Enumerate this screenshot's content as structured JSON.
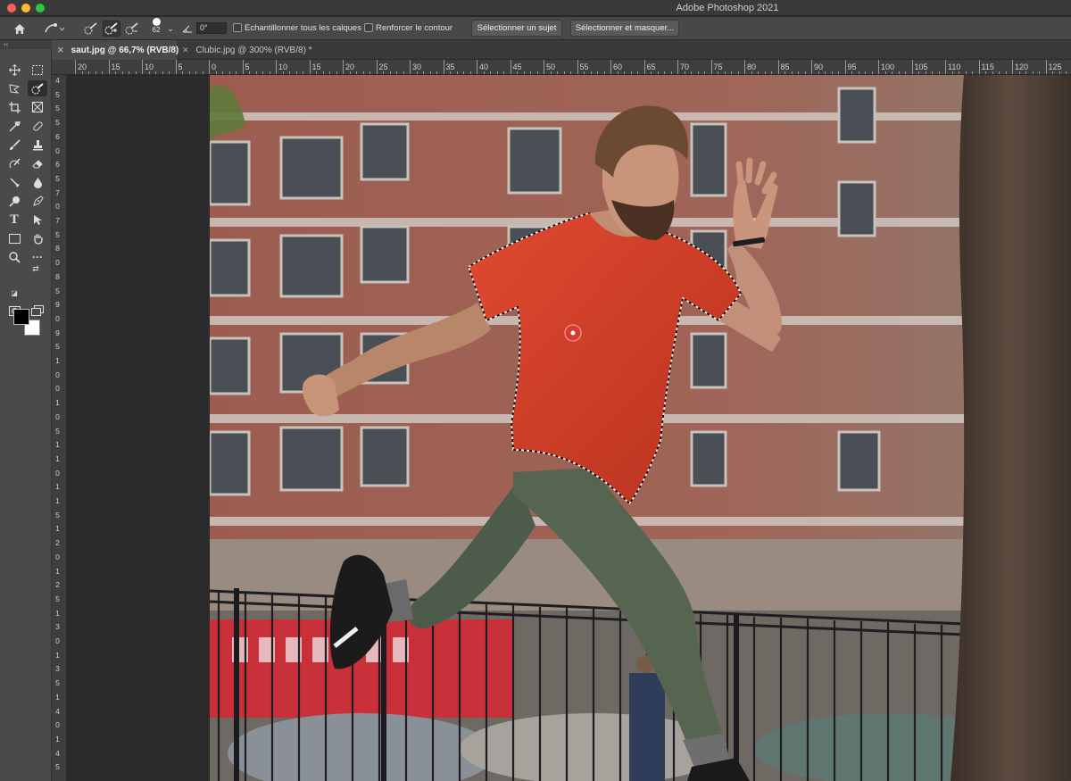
{
  "titlebar": {
    "app_title": "Adobe Photoshop 2021"
  },
  "options": {
    "brush_size": "62",
    "angle": "0°",
    "sample_all_layers": "Echantillonner tous les calques",
    "enhance_edge": "Renforcer le contour",
    "select_subject": "Sélectionner un sujet",
    "select_and_mask": "Sélectionner et masquer..."
  },
  "tabs": [
    {
      "label": "saut.jpg @ 66,7% (RVB/8)",
      "active": true
    },
    {
      "label": "Clubic.jpg @ 300% (RVB/8) *",
      "active": false
    }
  ],
  "ruler": {
    "top": [
      "20",
      "15",
      "10",
      "5",
      "0",
      "5",
      "10",
      "15",
      "20",
      "25",
      "30",
      "35",
      "40",
      "45",
      "50",
      "55",
      "60",
      "65",
      "70",
      "75",
      "80",
      "85",
      "90",
      "95",
      "100",
      "105",
      "110",
      "115",
      "120",
      "125"
    ],
    "left": [
      "4",
      "5",
      "5",
      "5",
      "6",
      "0",
      "6",
      "5",
      "7",
      "0",
      "7",
      "5",
      "8",
      "0",
      "8",
      "5",
      "9",
      "0",
      "9",
      "5",
      "1",
      "0",
      "0",
      "1",
      "0",
      "5",
      "1",
      "1",
      "0",
      "1",
      "1",
      "5",
      "1",
      "2",
      "0",
      "1",
      "2",
      "5",
      "1",
      "3",
      "0",
      "1",
      "3",
      "5",
      "1",
      "4",
      "0",
      "1",
      "4",
      "5"
    ]
  },
  "toolbar": {
    "collapse_label": "‹‹",
    "foreground_color": "#000000",
    "background_color": "#ffffff"
  },
  "colors": {
    "shirt": "#d2402c",
    "pants": "#4d5c4a",
    "brick": "#9b5a4c"
  }
}
